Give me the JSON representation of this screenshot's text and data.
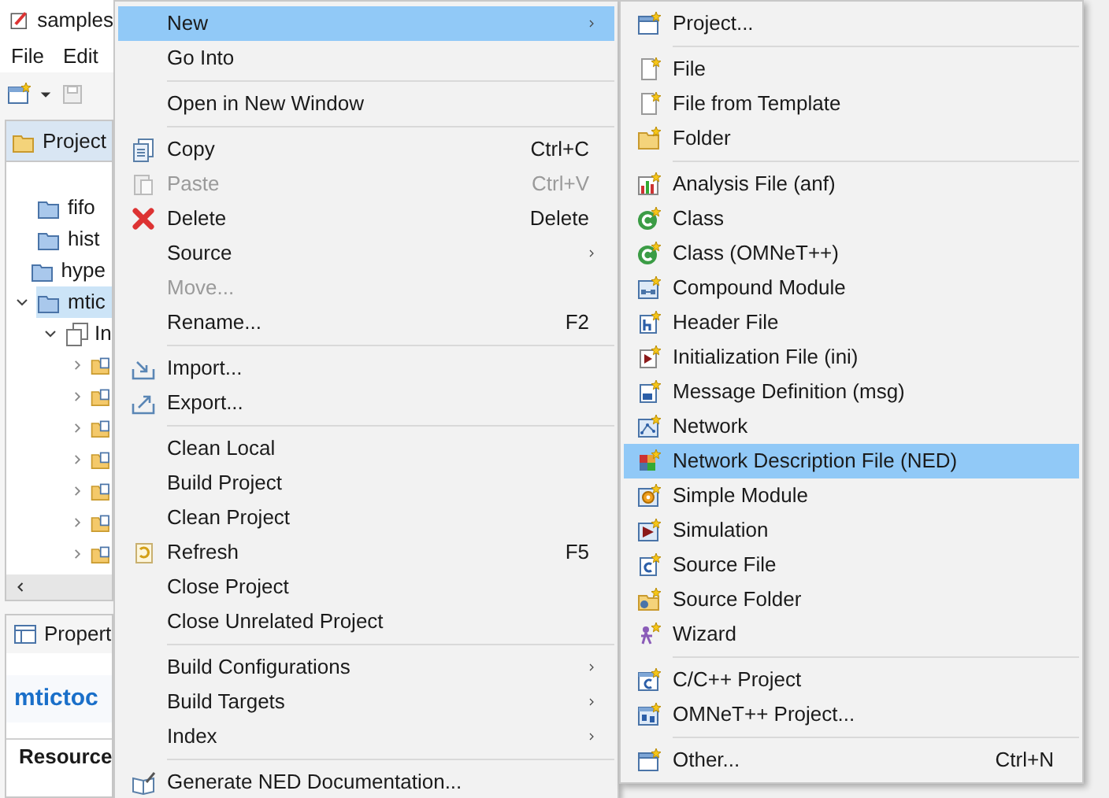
{
  "window": {
    "title": "samples"
  },
  "menu_bar": [
    "File",
    "Edit"
  ],
  "project_explorer": {
    "tab": "Project",
    "items": [
      {
        "label": "fifo",
        "selected": false
      },
      {
        "label": "hist",
        "selected": false
      },
      {
        "label": "hype",
        "selected": false
      },
      {
        "label": "mtic",
        "selected": true,
        "expanded": true,
        "children": [
          {
            "label": "In",
            "expanded": true
          }
        ]
      }
    ]
  },
  "properties": {
    "tab": "Propert",
    "title": "mtictoc",
    "section_tab": "Resource"
  },
  "context_menu": [
    {
      "kind": "item",
      "label": "New",
      "submenu": true,
      "selected": true,
      "disabled": false
    },
    {
      "kind": "item",
      "label": "Go Into",
      "submenu": false,
      "selected": false,
      "disabled": false
    },
    {
      "kind": "separator"
    },
    {
      "kind": "item",
      "label": "Open in New Window",
      "submenu": false,
      "selected": false,
      "disabled": false
    },
    {
      "kind": "separator"
    },
    {
      "kind": "item",
      "label": "Copy",
      "shortcut": "Ctrl+C",
      "submenu": false,
      "selected": false,
      "disabled": false
    },
    {
      "kind": "item",
      "label": "Paste",
      "shortcut": "Ctrl+V",
      "submenu": false,
      "selected": false,
      "disabled": true
    },
    {
      "kind": "item",
      "label": "Delete",
      "shortcut": "Delete",
      "submenu": false,
      "selected": false,
      "disabled": false
    },
    {
      "kind": "item",
      "label": "Source",
      "submenu": true,
      "selected": false,
      "disabled": false
    },
    {
      "kind": "item",
      "label": "Move...",
      "submenu": false,
      "selected": false,
      "disabled": true
    },
    {
      "kind": "item",
      "label": "Rename...",
      "shortcut": "F2",
      "submenu": false,
      "selected": false,
      "disabled": false
    },
    {
      "kind": "separator"
    },
    {
      "kind": "item",
      "label": "Import...",
      "submenu": false,
      "selected": false,
      "disabled": false
    },
    {
      "kind": "item",
      "label": "Export...",
      "submenu": false,
      "selected": false,
      "disabled": false
    },
    {
      "kind": "separator"
    },
    {
      "kind": "item",
      "label": "Clean Local",
      "submenu": false,
      "selected": false,
      "disabled": false
    },
    {
      "kind": "item",
      "label": "Build Project",
      "submenu": false,
      "selected": false,
      "disabled": false
    },
    {
      "kind": "item",
      "label": "Clean Project",
      "submenu": false,
      "selected": false,
      "disabled": false
    },
    {
      "kind": "item",
      "label": "Refresh",
      "shortcut": "F5",
      "submenu": false,
      "selected": false,
      "disabled": false
    },
    {
      "kind": "item",
      "label": "Close Project",
      "submenu": false,
      "selected": false,
      "disabled": false
    },
    {
      "kind": "item",
      "label": "Close Unrelated Project",
      "submenu": false,
      "selected": false,
      "disabled": false
    },
    {
      "kind": "separator"
    },
    {
      "kind": "item",
      "label": "Build Configurations",
      "submenu": true,
      "selected": false,
      "disabled": false
    },
    {
      "kind": "item",
      "label": "Build Targets",
      "submenu": true,
      "selected": false,
      "disabled": false
    },
    {
      "kind": "item",
      "label": "Index",
      "submenu": true,
      "selected": false,
      "disabled": false
    },
    {
      "kind": "separator"
    },
    {
      "kind": "item",
      "label": "Generate NED Documentation...",
      "submenu": false,
      "selected": false,
      "disabled": false
    }
  ],
  "new_submenu": [
    {
      "kind": "item",
      "label": "Project...",
      "selected": false
    },
    {
      "kind": "separator"
    },
    {
      "kind": "item",
      "label": "File",
      "selected": false
    },
    {
      "kind": "item",
      "label": "File from Template",
      "selected": false
    },
    {
      "kind": "item",
      "label": "Folder",
      "selected": false
    },
    {
      "kind": "separator"
    },
    {
      "kind": "item",
      "label": "Analysis File (anf)",
      "selected": false
    },
    {
      "kind": "item",
      "label": "Class",
      "selected": false
    },
    {
      "kind": "item",
      "label": "Class (OMNeT++)",
      "selected": false
    },
    {
      "kind": "item",
      "label": "Compound Module",
      "selected": false
    },
    {
      "kind": "item",
      "label": "Header File",
      "selected": false
    },
    {
      "kind": "item",
      "label": "Initialization File (ini)",
      "selected": false
    },
    {
      "kind": "item",
      "label": "Message Definition (msg)",
      "selected": false
    },
    {
      "kind": "item",
      "label": "Network",
      "selected": false
    },
    {
      "kind": "item",
      "label": "Network Description File (NED)",
      "selected": true
    },
    {
      "kind": "item",
      "label": "Simple Module",
      "selected": false
    },
    {
      "kind": "item",
      "label": "Simulation",
      "selected": false
    },
    {
      "kind": "item",
      "label": "Source File",
      "selected": false
    },
    {
      "kind": "item",
      "label": "Source Folder",
      "selected": false
    },
    {
      "kind": "item",
      "label": "Wizard",
      "selected": false
    },
    {
      "kind": "separator"
    },
    {
      "kind": "item",
      "label": "C/C++ Project",
      "selected": false
    },
    {
      "kind": "item",
      "label": "OMNeT++ Project...",
      "selected": false
    },
    {
      "kind": "separator"
    },
    {
      "kind": "item",
      "label": "Other...",
      "shortcut": "Ctrl+N",
      "selected": false
    }
  ]
}
